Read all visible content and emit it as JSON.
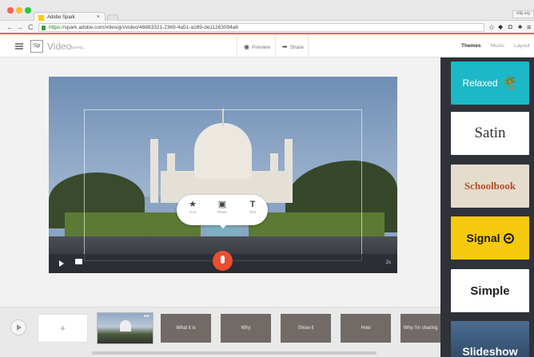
{
  "browser": {
    "tab_title": "Adobe Spark",
    "tab_close": "×",
    "user_button": "cltkj.org",
    "url_secure": "https://",
    "url_host": "spark.adobe.com",
    "url_path": "/#design/video/48883321-2369-4a51-a189-de11263094a8",
    "nav_back": "←",
    "nav_forward": "→",
    "nav_reload": "C",
    "ext_star": "☆",
    "ext_menu": "≡"
  },
  "header": {
    "logo": "Sp",
    "product": "Video",
    "status": "Saving...",
    "preview_label": "Preview",
    "share_label": "Share",
    "tabs": [
      {
        "label": "Themes",
        "active": true
      },
      {
        "label": "Music",
        "active": false
      },
      {
        "label": "Layout",
        "active": false
      }
    ]
  },
  "canvas": {
    "popup_items": [
      {
        "icon": "star-icon",
        "glyph": "★",
        "label": "Icon"
      },
      {
        "icon": "photo-icon",
        "glyph": "▣",
        "label": "Photo"
      },
      {
        "icon": "text-icon",
        "glyph": "T",
        "label": "Text"
      }
    ],
    "duration": "2s"
  },
  "timeline": {
    "add_label": "+",
    "more": "•••",
    "slides": [
      "What it is",
      "Why",
      "Show it",
      "How",
      "Why I'm sharing"
    ]
  },
  "themes": {
    "items": [
      "Relaxed",
      "Satin",
      "Schoolbook",
      "Signal",
      "Simple",
      "Slideshow"
    ],
    "colors": {
      "relaxed": "#1cb8c7",
      "signal": "#f5c90e",
      "schoolbook": "#b34f2a"
    }
  },
  "colors": {
    "accent": "#f06a35",
    "mic": "#ea4d2f"
  }
}
